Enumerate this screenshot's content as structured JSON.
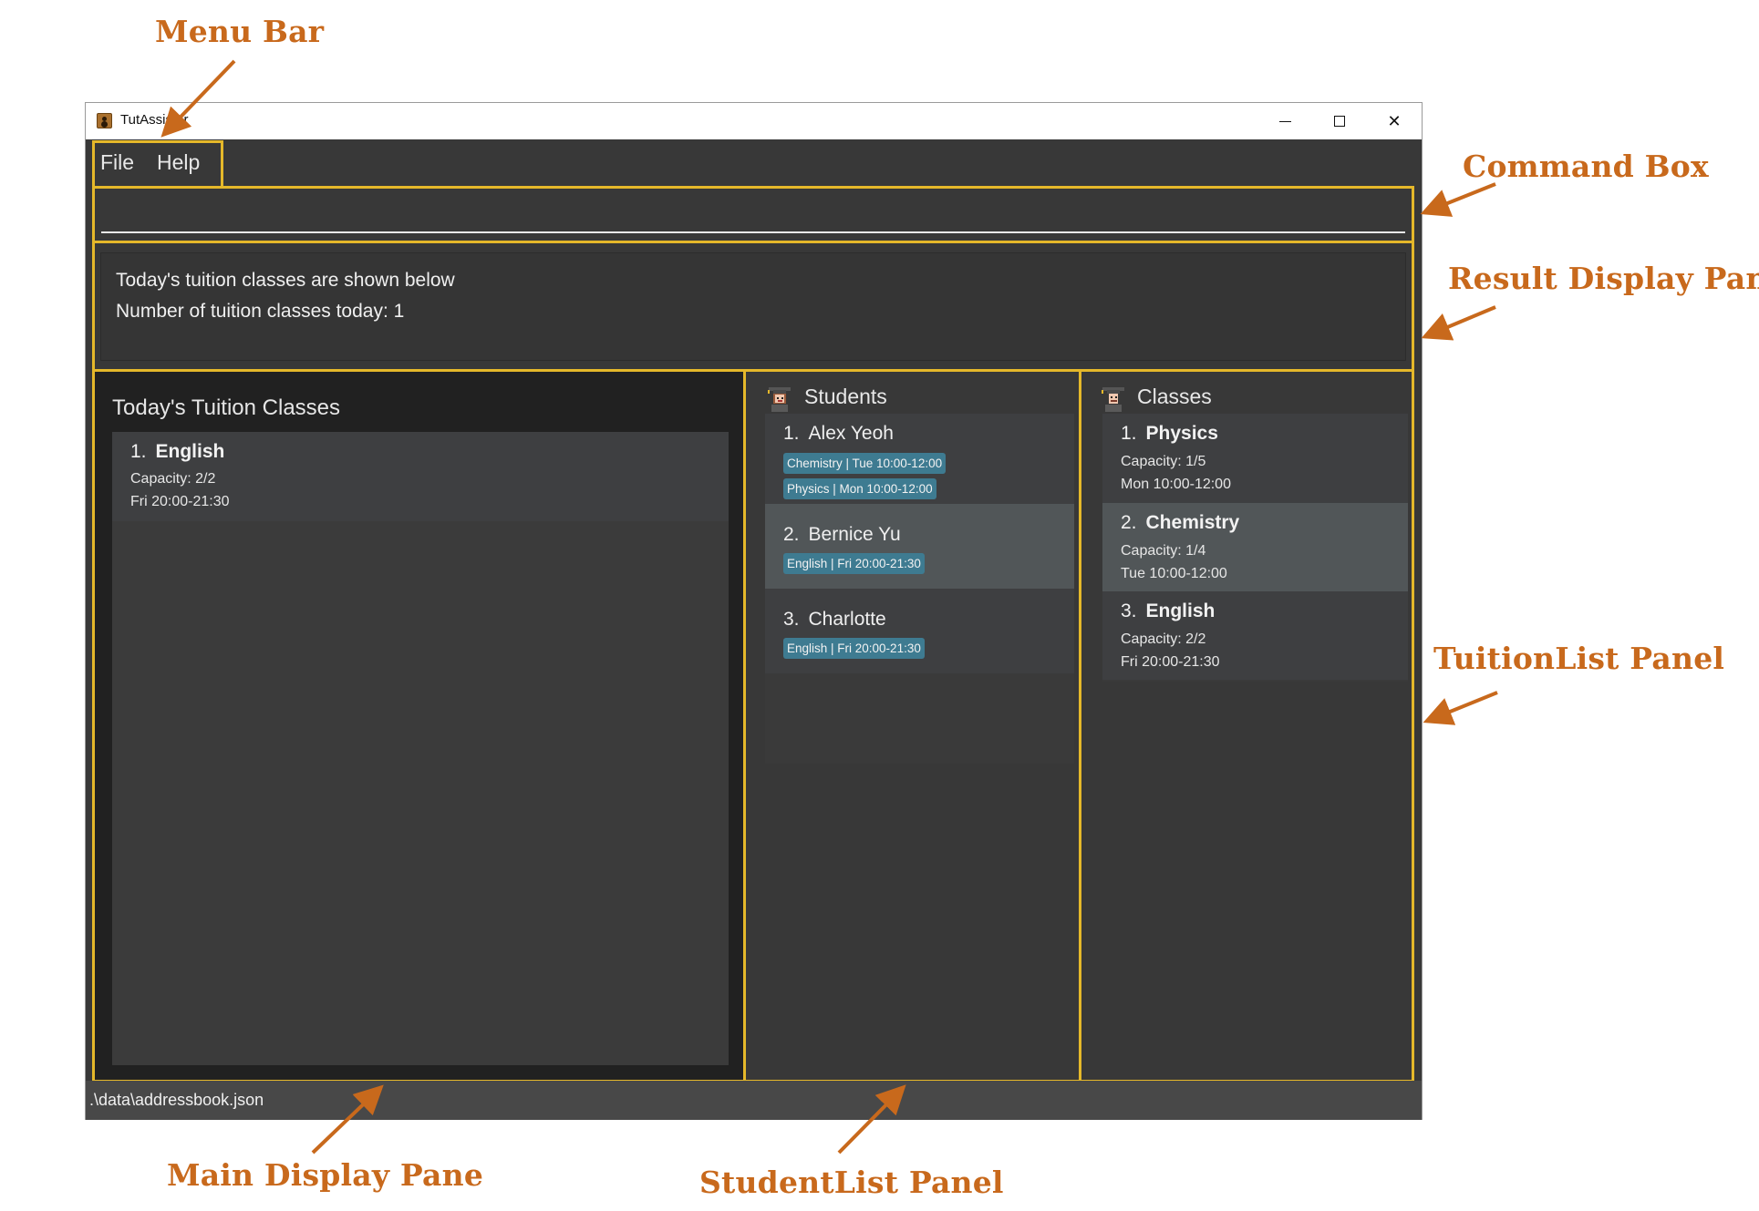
{
  "window": {
    "title": "TutAssistor",
    "controls": {
      "minimize": "minimize-icon",
      "maximize": "maximize-icon",
      "close": "close-icon"
    }
  },
  "menu": {
    "items": [
      {
        "label": "File"
      },
      {
        "label": "Help"
      }
    ]
  },
  "command_box": {
    "value": "",
    "placeholder": ""
  },
  "result_display": {
    "lines": [
      "Today's tuition classes are shown below",
      "Number of tuition classes today: 1"
    ]
  },
  "main_display": {
    "title": "Today's Tuition Classes",
    "classes": [
      {
        "index": "1.",
        "name": "English",
        "capacity": "Capacity: 2/2",
        "time": "Fri 20:00-21:30"
      }
    ]
  },
  "students_panel": {
    "title": "Students",
    "icon": "graduate-icon",
    "students": [
      {
        "index": "1.",
        "name": "Alex Yeoh",
        "tags": [
          "Chemistry | Tue 10:00-12:00",
          "Physics | Mon 10:00-12:00"
        ],
        "selected": false
      },
      {
        "index": "2.",
        "name": "Bernice Yu",
        "tags": [
          "English | Fri 20:00-21:30"
        ],
        "selected": true
      },
      {
        "index": "3.",
        "name": "Charlotte",
        "tags": [
          "English | Fri 20:00-21:30"
        ],
        "selected": false
      }
    ]
  },
  "classes_panel": {
    "title": "Classes",
    "icon": "teacher-icon",
    "classes": [
      {
        "index": "1.",
        "name": "Physics",
        "capacity": "Capacity: 1/5",
        "time": "Mon 10:00-12:00",
        "selected": false
      },
      {
        "index": "2.",
        "name": "Chemistry",
        "capacity": "Capacity: 1/4",
        "time": "Tue 10:00-12:00",
        "selected": true
      },
      {
        "index": "3.",
        "name": "English",
        "capacity": "Capacity: 2/2",
        "time": "Fri 20:00-21:30",
        "selected": false
      }
    ]
  },
  "status_bar": {
    "path": ".\\data\\addressbook.json"
  },
  "annotations": {
    "menu_bar": "Menu Bar",
    "command_box": "Command Box",
    "result_display_pane": "Result Display Pane",
    "tuition_list_panel": "TuitionList Panel",
    "main_display_pane": "Main Display Pane",
    "student_list_panel": "StudentList Panel"
  },
  "colors": {
    "highlight_border": "#e5b82a",
    "annotation": "#c8691c",
    "tag": "#3e7b91",
    "selected_row": "#515658"
  }
}
